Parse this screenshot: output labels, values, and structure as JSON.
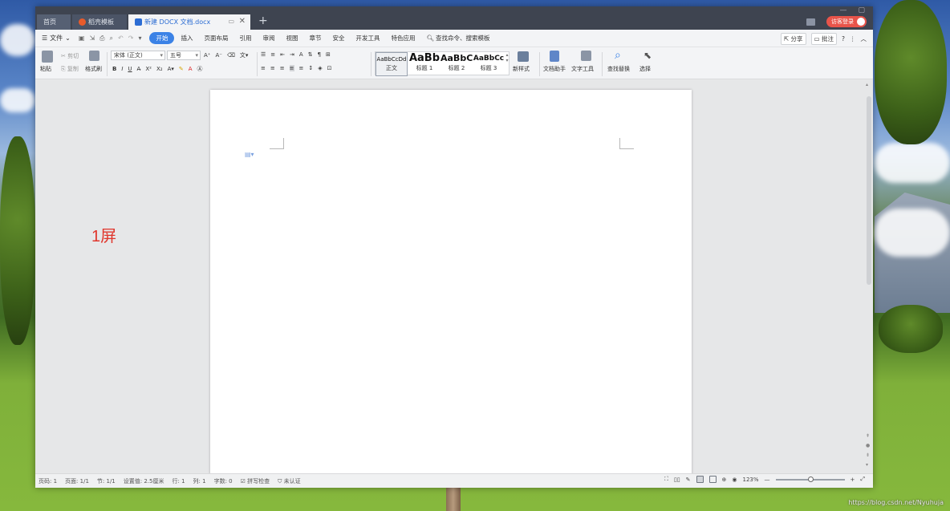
{
  "tabs": {
    "home": "首页",
    "templates": "稻壳模板",
    "document": "新建 DOCX 文档.docx"
  },
  "titlebar": {
    "visitor_login": "访客登录"
  },
  "menubar": {
    "file": "文件",
    "menus": [
      "开始",
      "插入",
      "页面布局",
      "引用",
      "审阅",
      "视图",
      "章节",
      "安全",
      "开发工具",
      "特色应用"
    ],
    "search_commands": "查找命令、搜索模板",
    "share": "分享",
    "comment": "批注"
  },
  "ribbon": {
    "paste": "粘贴",
    "cut": "剪切",
    "copy": "复制",
    "format_painter": "格式刷",
    "font_name": "宋体 (正文)",
    "font_size": "五号",
    "style_body_preview": "AaBbCcDd",
    "style_body": "正文",
    "style_h1_preview": "AaBb",
    "style_h1": "标题 1",
    "style_h2_preview": "AaBbC",
    "style_h2": "标题 2",
    "style_h3_preview": "AaBbCc",
    "style_h3": "标题 3",
    "new_style": "新样式",
    "doc_assistant": "文档助手",
    "text_tools": "文字工具",
    "find_replace": "查找替换",
    "select": "选择"
  },
  "workspace": {
    "annotation": "1屏"
  },
  "statusbar": {
    "page_num": "页码: 1",
    "pages": "页面: 1/1",
    "section": "节: 1/1",
    "setting": "设置值: 2.5厘米",
    "line": "行: 1",
    "column": "列: 1",
    "words": "字数: 0",
    "spell_check": "拼写检查",
    "uncertified": "未认证",
    "zoom": "123%"
  },
  "watermark": "https://blog.csdn.net/Nyuhuja",
  "colors": {
    "accent": "#3b82e6",
    "titlebar": "#3e4450",
    "visitor": "#e8544a",
    "annotation": "#e0352b"
  }
}
